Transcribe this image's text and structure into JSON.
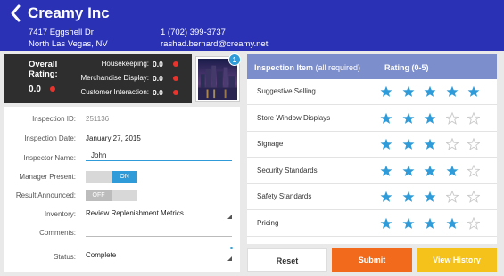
{
  "header": {
    "title": "Creamy Inc",
    "address_line1": "7417 Eggshell Dr",
    "address_line2": "North Las Vegas, NV",
    "phone": "1 (702) 399-3737",
    "email": "rashad.bernard@creamy.net"
  },
  "summary": {
    "overall_label": "Overall Rating:",
    "overall_value": "0.0",
    "items": [
      {
        "label": "Housekeeping:",
        "value": "0.0"
      },
      {
        "label": "Merchandise Display:",
        "value": "0.0"
      },
      {
        "label": "Customer Interaction:",
        "value": "0.0"
      }
    ],
    "photo_count": "1"
  },
  "form": {
    "inspection_id_label": "Inspection ID:",
    "inspection_id_value": "251136",
    "inspection_date_label": "Inspection Date:",
    "inspection_date_value": "January 27, 2015",
    "inspector_name_label": "Inspector Name:",
    "inspector_name_value": "John",
    "manager_present_label": "Manager Present:",
    "manager_present_state": "ON",
    "result_announced_label": "Result Announced:",
    "result_announced_state": "OFF",
    "inventory_label": "Inventory:",
    "inventory_value": "Review Replenishment Metrics",
    "comments_label": "Comments:",
    "comments_value": "",
    "status_label": "Status:",
    "status_value": "Complete"
  },
  "inspection": {
    "col_item": "Inspection Item",
    "col_item_note": "(all required)",
    "col_rating": "Rating (0-5)",
    "max_stars": 5,
    "rows": [
      {
        "name": "Suggestive Selling",
        "rating": 5
      },
      {
        "name": "Store Window Displays",
        "rating": 3
      },
      {
        "name": "Signage",
        "rating": 3
      },
      {
        "name": "Security Standards",
        "rating": 4
      },
      {
        "name": "Safety Standards",
        "rating": 3
      },
      {
        "name": "Pricing",
        "rating": 4
      }
    ]
  },
  "buttons": {
    "reset": "Reset",
    "submit": "Submit",
    "history": "View History"
  },
  "colors": {
    "header_bg": "#2a31b5",
    "accent_blue": "#2f9bd8",
    "submit_orange": "#f26a1b",
    "history_yellow": "#f4c21b",
    "rating_dot_red": "#e8342c"
  }
}
